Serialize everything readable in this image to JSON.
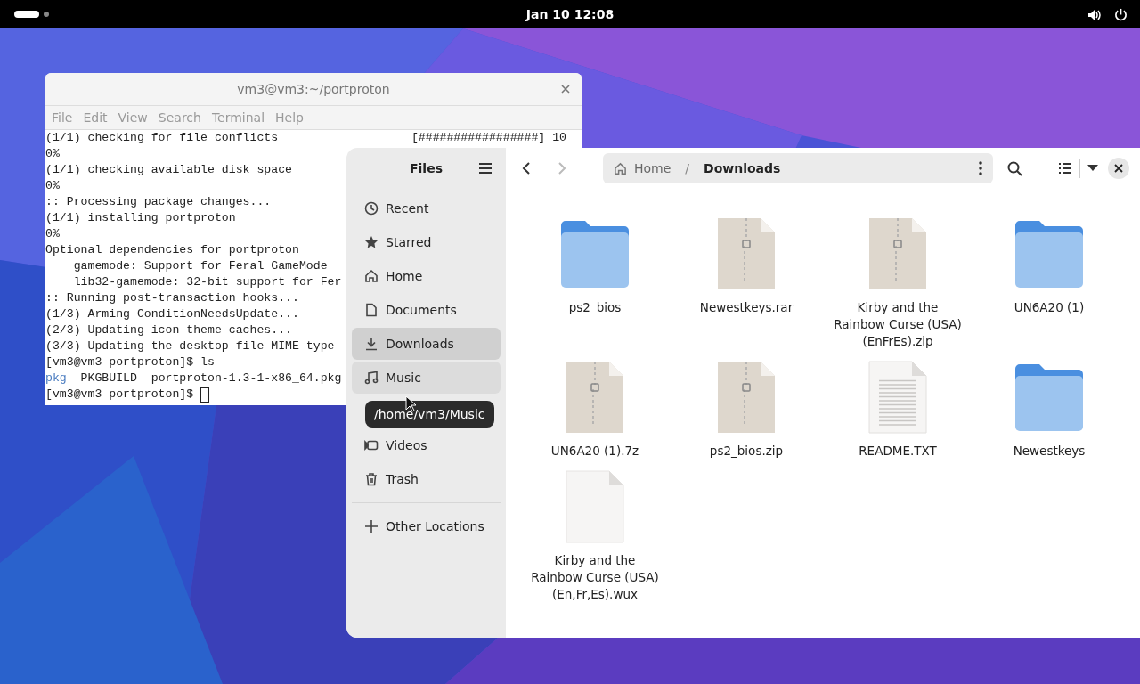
{
  "top_bar": {
    "clock": "Jan 10  12:08"
  },
  "terminal": {
    "title": "vm3@vm3:~/portproton",
    "menu": [
      "File",
      "Edit",
      "View",
      "Search",
      "Terminal",
      "Help"
    ],
    "lines": [
      {
        "kind": "progress",
        "text": "(1/1) checking for file conflicts",
        "right": "[#################] 10"
      },
      {
        "kind": "plain",
        "text": "0%"
      },
      {
        "kind": "plain",
        "text": "(1/1) checking available disk space"
      },
      {
        "kind": "plain",
        "text": "0%"
      },
      {
        "kind": "plain",
        "text": ":: Processing package changes..."
      },
      {
        "kind": "plain",
        "text": "(1/1) installing portproton"
      },
      {
        "kind": "plain",
        "text": "0%"
      },
      {
        "kind": "plain",
        "text": "Optional dependencies for portproton"
      },
      {
        "kind": "plain",
        "text": "    gamemode: Support for Feral GameMode"
      },
      {
        "kind": "plain",
        "text": "    lib32-gamemode: 32-bit support for Fer"
      },
      {
        "kind": "plain",
        "text": ":: Running post-transaction hooks..."
      },
      {
        "kind": "plain",
        "text": "(1/3) Arming ConditionNeedsUpdate..."
      },
      {
        "kind": "plain",
        "text": "(2/3) Updating icon theme caches..."
      },
      {
        "kind": "plain",
        "text": "(3/3) Updating the desktop file MIME type"
      },
      {
        "kind": "plain",
        "text": "[vm3@vm3 portproton]$ ls"
      },
      {
        "kind": "listing",
        "dir": "pkg",
        "text": "  PKGBUILD  portproton-1.3-1-x86_64.pkg"
      },
      {
        "kind": "prompt",
        "text": "[vm3@vm3 portproton]$ "
      }
    ]
  },
  "files": {
    "title": "Files",
    "sidebar": [
      {
        "label": "Recent",
        "selected": false,
        "hovered": false
      },
      {
        "label": "Starred",
        "selected": false,
        "hovered": false
      },
      {
        "label": "Home",
        "selected": false,
        "hovered": false
      },
      {
        "label": "Documents",
        "selected": false,
        "hovered": false
      },
      {
        "label": "Downloads",
        "selected": true,
        "hovered": false
      },
      {
        "label": "Music",
        "selected": false,
        "hovered": true
      },
      {
        "label": "Videos",
        "selected": false,
        "hovered": false
      },
      {
        "label": "Trash",
        "selected": false,
        "hovered": false
      }
    ],
    "other_locations": "Other Locations",
    "tooltip": "/home/vm3/Music",
    "path": [
      "Home",
      "Downloads"
    ],
    "path_separator": "/",
    "items": [
      {
        "name": "ps2_bios",
        "kind": "folder"
      },
      {
        "name": "Newestkeys.rar",
        "kind": "archive"
      },
      {
        "name": "Kirby and the Rainbow Curse (USA) (EnFrEs).zip",
        "kind": "archive"
      },
      {
        "name": "UN6A20 (1)",
        "kind": "folder"
      },
      {
        "name": "UN6A20 (1).7z",
        "kind": "archive"
      },
      {
        "name": "ps2_bios.zip",
        "kind": "archive"
      },
      {
        "name": "README.TXT",
        "kind": "text"
      },
      {
        "name": "Newestkeys",
        "kind": "folder"
      },
      {
        "name": "Kirby and the Rainbow Curse (USA) (En,Fr,Es).wux",
        "kind": "blank"
      }
    ]
  }
}
